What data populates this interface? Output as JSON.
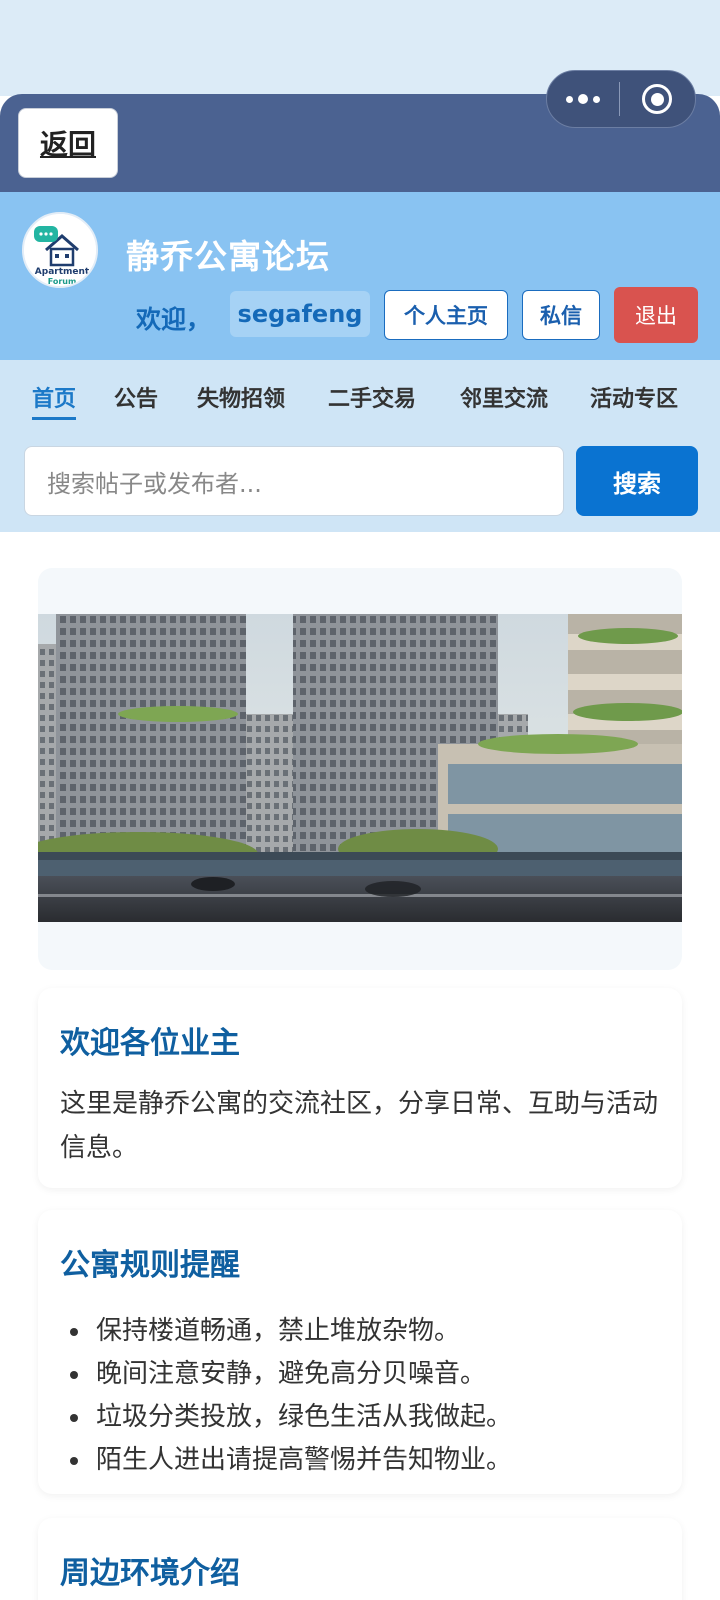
{
  "topbar": {
    "back_label": "返回"
  },
  "header": {
    "logo_text_line1": "Apartment",
    "logo_text_line2": "Forum",
    "site_title": "静乔公寓论坛",
    "welcome": "欢迎，",
    "username": "segafeng",
    "profile_label": "个人主页",
    "message_label": "私信",
    "logout_label": "退出"
  },
  "nav": {
    "items": [
      "首页",
      "公告",
      "失物招领",
      "二手交易",
      "邻里交流",
      "活动专区"
    ],
    "active": "首页"
  },
  "search": {
    "placeholder": "搜索帖子或发布者...",
    "button_label": "搜索"
  },
  "welcome_card": {
    "title": "欢迎各位业主",
    "body": "这里是静乔公寓的交流社区，分享日常、互助与活动信息。"
  },
  "rules_card": {
    "title": "公寓规则提醒",
    "items": [
      "保持楼道畅通，禁止堆放杂物。",
      "晚间注意安静，避免高分贝噪音。",
      "垃圾分类投放，绿色生活从我做起。",
      "陌生人进出请提高警惕并告知物业。"
    ]
  },
  "environment_card": {
    "title": "周边环境介绍"
  },
  "colors": {
    "topbar": "#4b6291",
    "header": "#89c3f2",
    "nav": "#cfe5f6",
    "accent": "#0a73d1",
    "logout": "#d9534f",
    "heading": "#0f5fa0"
  }
}
